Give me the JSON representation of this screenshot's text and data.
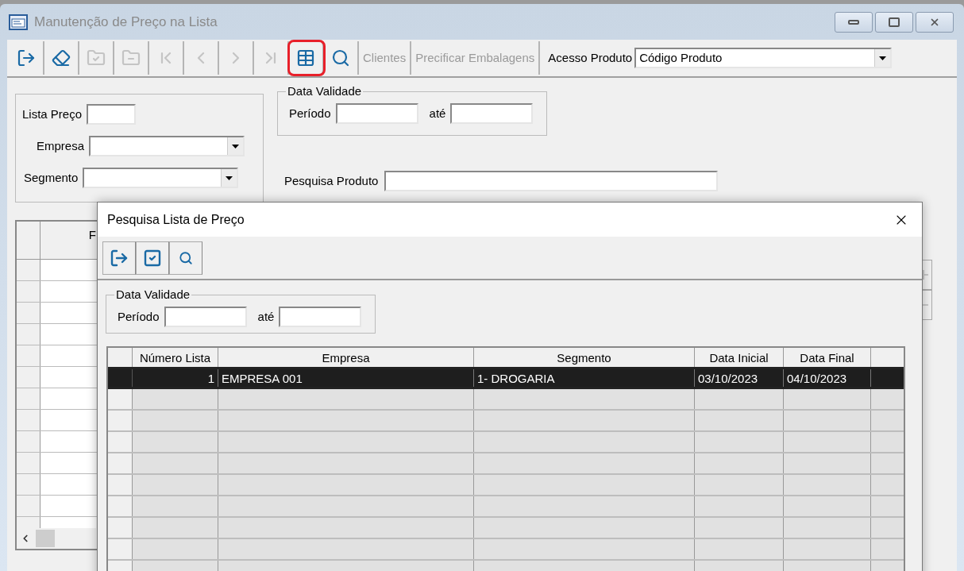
{
  "window": {
    "title": "Manutenção de Preço na Lista"
  },
  "toolbar": [
    {
      "kind": "icon",
      "disabled": false,
      "highlighted": false
    },
    {
      "kind": "icon",
      "disabled": false,
      "highlighted": false
    },
    {
      "kind": "icon",
      "disabled": true,
      "highlighted": false
    },
    {
      "kind": "icon",
      "disabled": true,
      "highlighted": false
    },
    {
      "kind": "icon",
      "disabled": true,
      "highlighted": false
    },
    {
      "kind": "icon",
      "disabled": true,
      "highlighted": false
    },
    {
      "kind": "icon",
      "disabled": true,
      "highlighted": false
    },
    {
      "kind": "icon",
      "disabled": true,
      "highlighted": false
    },
    {
      "kind": "icon",
      "disabled": false,
      "highlighted": true
    },
    {
      "kind": "icon",
      "disabled": false,
      "highlighted": false
    },
    {
      "kind": "text",
      "label": "Clientes",
      "disabled": true,
      "highlighted": false
    },
    {
      "kind": "text",
      "label": "Precificar Embalagens",
      "disabled": true,
      "highlighted": false
    }
  ],
  "acesso_produto": {
    "label": "Acesso Produto",
    "value": "Código Produto"
  },
  "filters": {
    "lista_preco": {
      "label": "Lista Preço"
    },
    "empresa": {
      "label": "Empresa"
    },
    "segmento": {
      "label": "Segmento"
    }
  },
  "data_validade": {
    "title": "Data Validade",
    "periodo_label": "Período",
    "ate_label": "até"
  },
  "pesquisa_produto": {
    "label": "Pesquisa Produto"
  },
  "main_grid": {
    "column_1": "F"
  },
  "dialog": {
    "title": "Pesquisa Lista de Preço",
    "data_validade": {
      "title": "Data Validade",
      "periodo_label": "Período",
      "ate_label": "até"
    },
    "table": {
      "columns": [
        "Número Lista",
        "Empresa",
        "Segmento",
        "Data Inicial",
        "Data Final"
      ],
      "rows": [
        {
          "selected": true,
          "cells": [
            "1",
            "EMPRESA 001",
            "1- DROGARIA",
            "03/10/2023",
            "04/10/2023"
          ]
        }
      ]
    }
  }
}
